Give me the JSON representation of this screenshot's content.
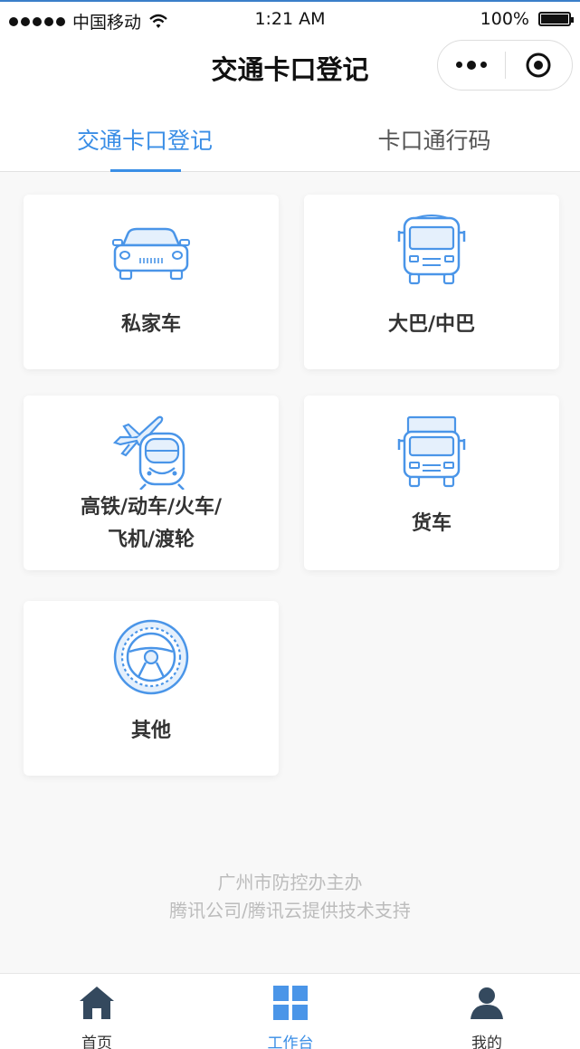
{
  "status_bar": {
    "carrier": "中国移动",
    "time": "1:21 AM",
    "battery": "100%"
  },
  "nav": {
    "title": "交通卡口登记"
  },
  "tabs": [
    {
      "label": "交通卡口登记",
      "active": true
    },
    {
      "label": "卡口通行码",
      "active": false
    }
  ],
  "cards": [
    {
      "label": "私家车",
      "icon": "car-icon"
    },
    {
      "label": "大巴/中巴",
      "icon": "bus-icon"
    },
    {
      "label_line1": "高铁/动车/火车/",
      "label_line2": "飞机/渡轮",
      "icon": "plane-train-icon"
    },
    {
      "label": "货车",
      "icon": "truck-icon"
    },
    {
      "label": "其他",
      "icon": "steering-wheel-icon"
    }
  ],
  "footer": {
    "line1": "广州市防控办主办",
    "line2": "腾讯公司/腾讯云提供技术支持"
  },
  "tab_bar": [
    {
      "label": "首页",
      "icon": "home-icon",
      "active": false
    },
    {
      "label": "工作台",
      "icon": "grid-icon",
      "active": true
    },
    {
      "label": "我的",
      "icon": "user-icon",
      "active": false
    }
  ],
  "colors": {
    "accent": "#3a8ee6",
    "icon_blue": "#4a95e8",
    "tab_dark": "#34495e"
  }
}
